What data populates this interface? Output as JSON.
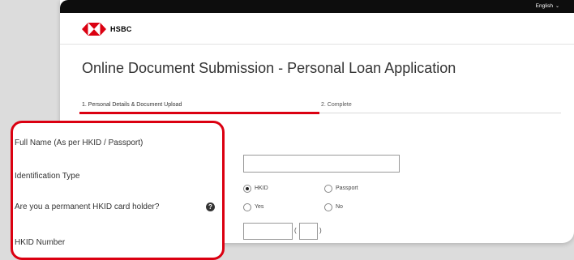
{
  "header": {
    "language": "English",
    "brand": "HSBC",
    "colors": {
      "brand_red": "#db0011",
      "topbar": "#0d0d0d"
    }
  },
  "page": {
    "title": "Online Document Submission - Personal Loan Application"
  },
  "steps": [
    {
      "label": "1. Personal Details & Document Upload",
      "active": true
    },
    {
      "label": "2. Complete",
      "active": false
    }
  ],
  "form": {
    "full_name": {
      "label": "Full Name (As per HKID / Passport)",
      "value": ""
    },
    "id_type": {
      "label": "Identification Type",
      "options": [
        "HKID",
        "Passport"
      ],
      "selected": "HKID"
    },
    "permanent_holder": {
      "label": "Are you a permanent HKID card holder?",
      "help_icon": "question-circle-icon",
      "options": [
        "Yes",
        "No"
      ],
      "selected": null
    },
    "hkid_number": {
      "label": "HKID Number",
      "value": "",
      "check_digit": "",
      "paren_open": "(",
      "paren_close": ")"
    }
  }
}
